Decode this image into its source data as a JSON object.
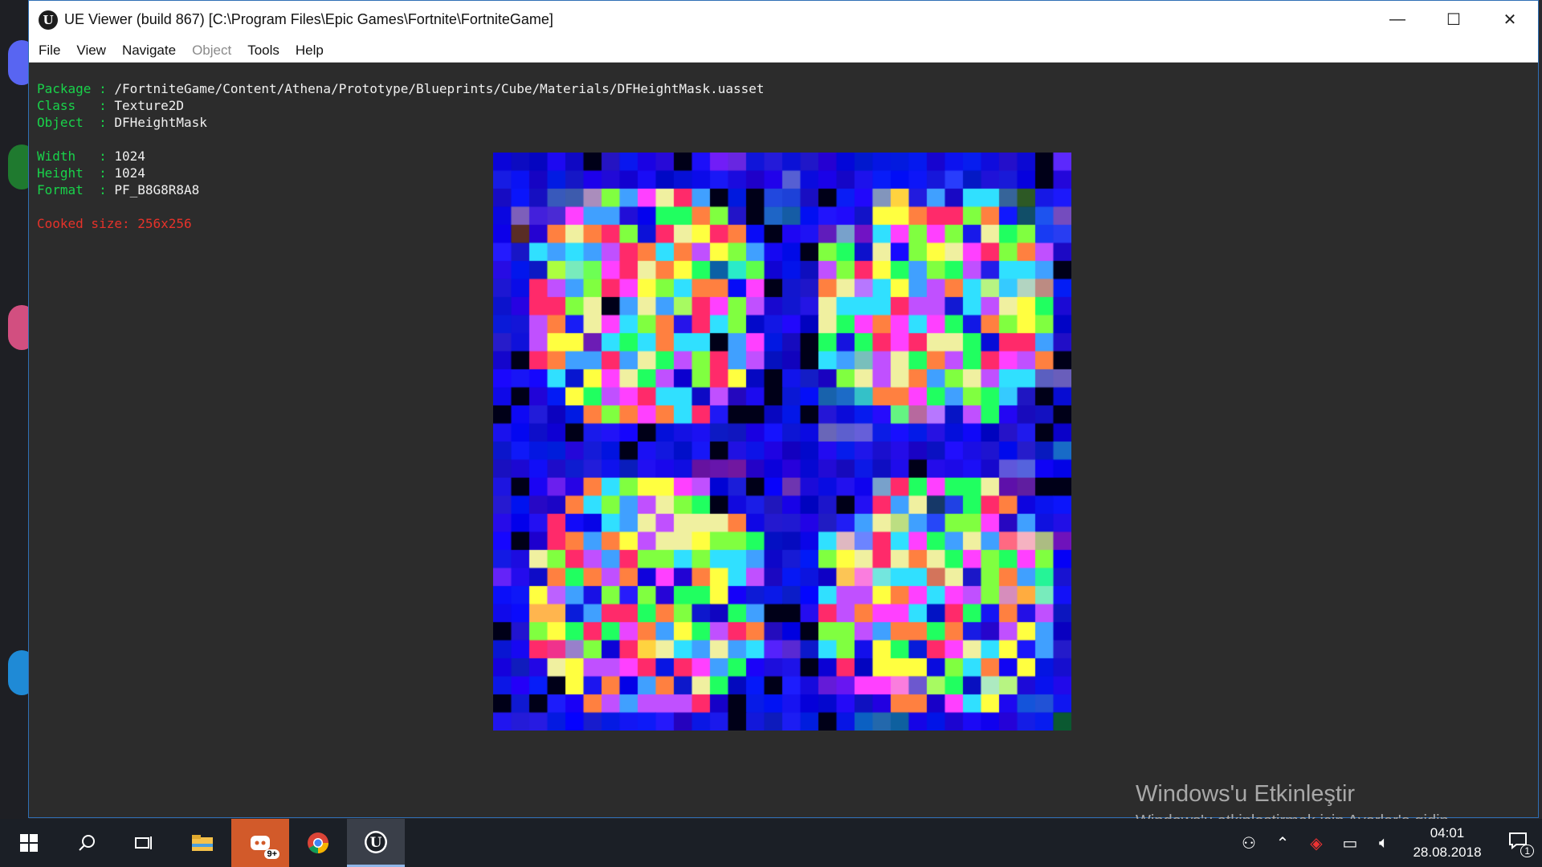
{
  "window": {
    "title": "UE Viewer (build 867) [C:\\Program Files\\Epic Games\\Fortnite\\FortniteGame]",
    "controls": {
      "minimize": "—",
      "maximize": "☐",
      "close": "✕"
    }
  },
  "menu": [
    {
      "label": "File",
      "enabled": true
    },
    {
      "label": "View",
      "enabled": true
    },
    {
      "label": "Navigate",
      "enabled": true
    },
    {
      "label": "Object",
      "enabled": false
    },
    {
      "label": "Tools",
      "enabled": true
    },
    {
      "label": "Help",
      "enabled": true
    }
  ],
  "asset": {
    "package_key": "Package",
    "package": "/FortniteGame/Content/Athena/Prototype/Blueprints/Cube/Materials/DFHeightMask.uasset",
    "class_key": "Class",
    "class": "Texture2D",
    "object_key": "Object",
    "object": "DFHeightMask",
    "width_key": "Width",
    "width": "1024",
    "height_key": "Height",
    "height": "1024",
    "format_key": "Format",
    "format": "PF_B8G8R8A8",
    "cooked": "Cooked size: 256x256"
  },
  "watermark": {
    "title": "Windows'u Etkinleştir",
    "subtitle": "Windows'u etkinleştirmek için Ayarlar'a gidin."
  },
  "taskbar": {
    "apps": [
      {
        "icon": "windows-start-icon"
      },
      {
        "icon": "search-icon"
      },
      {
        "icon": "task-view-icon"
      },
      {
        "icon": "file-explorer-icon"
      },
      {
        "icon": "discord-icon",
        "badge": "9+"
      },
      {
        "icon": "chrome-icon"
      },
      {
        "icon": "unreal-icon"
      }
    ],
    "time": "04:01",
    "date": "28.08.2018",
    "notification_count": "1"
  },
  "colors": {
    "key_green": "#19d24a",
    "warning_red": "#e6322a",
    "window_border": "#2f6fb5"
  }
}
